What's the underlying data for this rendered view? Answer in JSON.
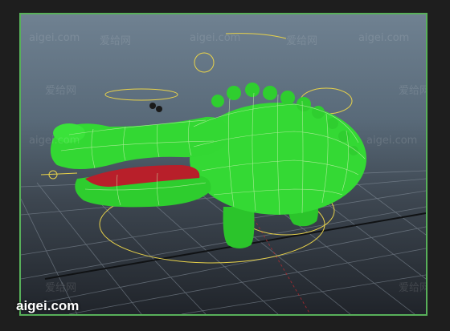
{
  "colors": {
    "viewport_border": "#58b05a",
    "model_green": "#2fd12f",
    "wireframe": "#c8f0b0",
    "control_curve": "#e8d24a",
    "mouth": "#b81f2a"
  },
  "watermarks": {
    "brand_corner": "aigei.com",
    "tile_cn": "爱给网",
    "tile_en": "aigei.com"
  }
}
